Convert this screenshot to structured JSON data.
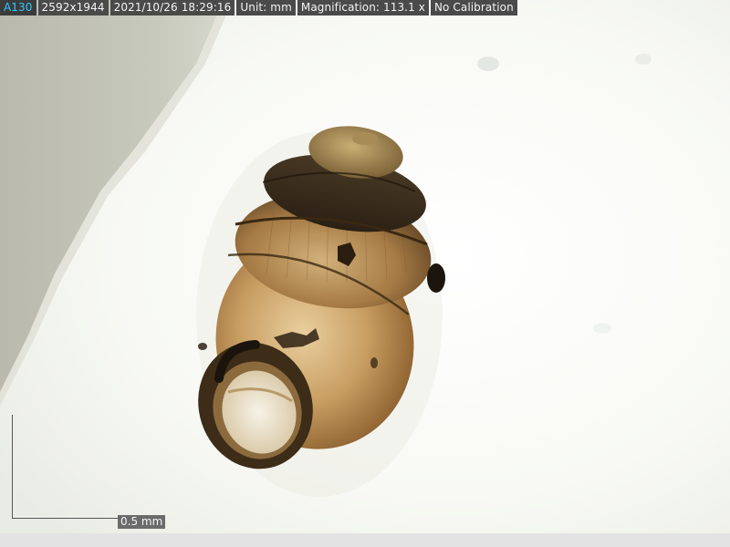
{
  "info_bar": {
    "model": "A130",
    "resolution": "2592x1944",
    "datetime": "2021/10/26 18:29:16",
    "unit": "Unit: mm",
    "magnification": "Magnification:  113.1 x",
    "calibration": "No Calibration"
  },
  "scale_bar": {
    "label": "0.5 mm"
  },
  "colors": {
    "info_bg": "#4a4a4a",
    "model_text": "#2ec8ff",
    "shell_dark": "#3a2c1a",
    "shell_light": "#c9a36a",
    "background_light": "#fbfbf8"
  },
  "specimen": {
    "subject": "snail shell"
  }
}
